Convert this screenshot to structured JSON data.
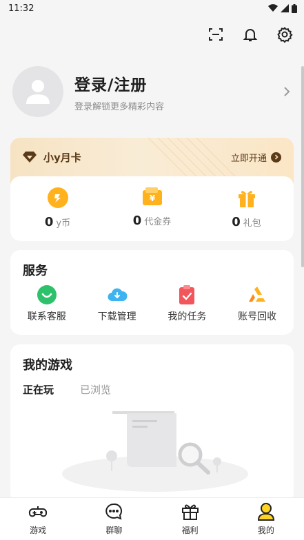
{
  "status_bar": {
    "time": "11:32"
  },
  "profile": {
    "title": "登录/注册",
    "subtitle": "登录解锁更多精彩内容"
  },
  "vip": {
    "title": "小y月卡",
    "action": "立即开通"
  },
  "wallet": [
    {
      "value": "0",
      "unit": "y币"
    },
    {
      "value": "0",
      "unit": "代金券"
    },
    {
      "value": "0",
      "unit": "礼包"
    }
  ],
  "services": {
    "title": "服务",
    "items": [
      {
        "label": "联系客服",
        "icon": "customer-service-icon"
      },
      {
        "label": "下载管理",
        "icon": "cloud-download-icon"
      },
      {
        "label": "我的任务",
        "icon": "task-clipboard-icon"
      },
      {
        "label": "账号回收",
        "icon": "recycle-icon"
      }
    ]
  },
  "my_games": {
    "title": "我的游戏",
    "tabs": [
      "正在玩",
      "已浏览"
    ]
  },
  "bottom_nav": [
    {
      "label": "游戏",
      "icon": "gamepad-icon"
    },
    {
      "label": "群聊",
      "icon": "chat-icon"
    },
    {
      "label": "福利",
      "icon": "gift-icon"
    },
    {
      "label": "我的",
      "icon": "user-icon"
    }
  ],
  "colors": {
    "accent": "#ffb21e",
    "vip_brown": "#5b3a17",
    "tab_highlight": "#ffe14a"
  }
}
